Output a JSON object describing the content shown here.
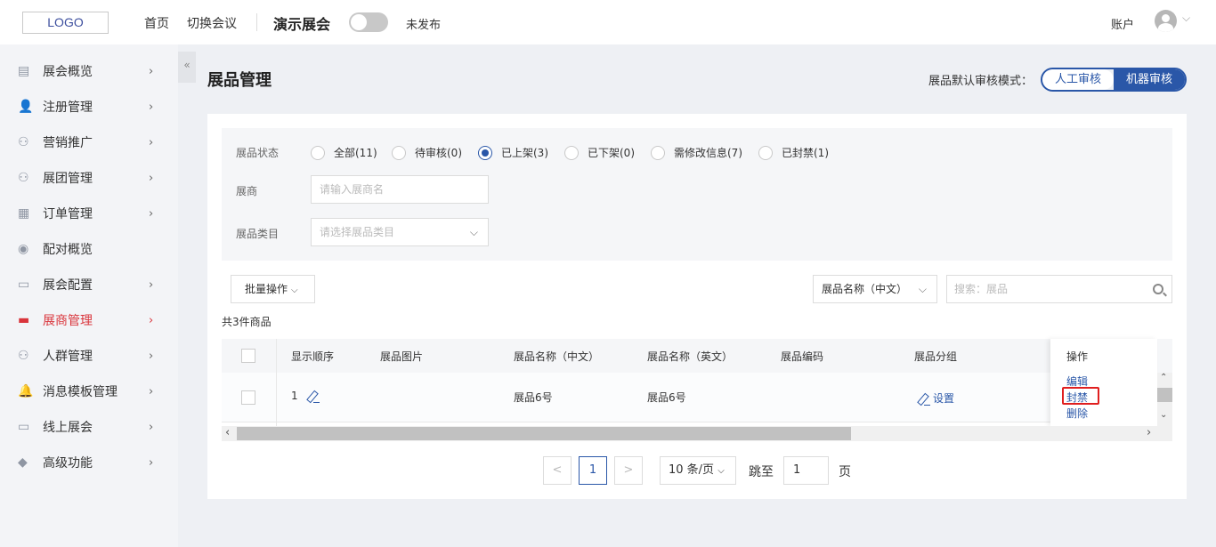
{
  "header": {
    "logo": "LOGO",
    "nav": [
      "首页",
      "切换会议"
    ],
    "expo_name": "演示展会",
    "publish_status": "未发布",
    "account": "账户"
  },
  "sidebar": {
    "collapse": "«",
    "items": [
      {
        "label": "展会概览",
        "icon": "document-icon",
        "chevron": true
      },
      {
        "label": "注册管理",
        "icon": "user-add-icon",
        "chevron": true
      },
      {
        "label": "营销推广",
        "icon": "group-icon",
        "chevron": true
      },
      {
        "label": "展团管理",
        "icon": "group-icon",
        "chevron": true
      },
      {
        "label": "订单管理",
        "icon": "order-icon",
        "chevron": true
      },
      {
        "label": "配对概览",
        "icon": "match-icon",
        "chevron": false
      },
      {
        "label": "展会配置",
        "icon": "monitor-icon",
        "chevron": true
      },
      {
        "label": "展商管理",
        "icon": "store-icon",
        "chevron": true,
        "active": true
      },
      {
        "label": "人群管理",
        "icon": "people-icon",
        "chevron": true
      },
      {
        "label": "消息模板管理",
        "icon": "bell-icon",
        "chevron": true
      },
      {
        "label": "线上展会",
        "icon": "monitor-icon",
        "chevron": true
      },
      {
        "label": "高级功能",
        "icon": "tag-icon",
        "chevron": true
      }
    ]
  },
  "main": {
    "title": "展品管理",
    "review_mode_label": "展品默认审核模式：",
    "review_options": [
      "人工审核",
      "机器审核"
    ],
    "filters": {
      "status_label": "展品状态",
      "status_options": [
        {
          "label": "全部(11)",
          "checked": false
        },
        {
          "label": "待审核(0)",
          "checked": false
        },
        {
          "label": "已上架(3)",
          "checked": true
        },
        {
          "label": "已下架(0)",
          "checked": false
        },
        {
          "label": "需修改信息(7)",
          "checked": false
        },
        {
          "label": "已封禁(1)",
          "checked": false
        }
      ],
      "exhibitor_label": "展商",
      "exhibitor_placeholder": "请输入展商名",
      "category_label": "展品类目",
      "category_placeholder": "请选择展品类目"
    },
    "batch_button": "批量操作",
    "search_field_select": "展品名称（中文）",
    "search_placeholder": "搜索：展品",
    "count_text": "共3件商品",
    "table": {
      "headers": [
        "显示顺序",
        "展品图片",
        "展品名称（中文）",
        "展品名称（英文）",
        "展品编码",
        "展品分组"
      ],
      "op_header": "操作",
      "rows": [
        {
          "order": "1",
          "image": "",
          "name_cn": "展品6号",
          "name_en": "展品6号",
          "code": "",
          "group_action": "设置"
        }
      ],
      "actions": [
        "编辑",
        "封禁",
        "删除"
      ]
    },
    "pagination": {
      "prev": "<",
      "current": "1",
      "next": ">",
      "page_size": "10 条/页",
      "jump_label": "跳至",
      "jump_value": "1",
      "page_unit": "页"
    }
  },
  "colors": {
    "primary": "#2a57a8",
    "active_menu": "#d9343b",
    "highlight_border": "#e01f1f"
  }
}
